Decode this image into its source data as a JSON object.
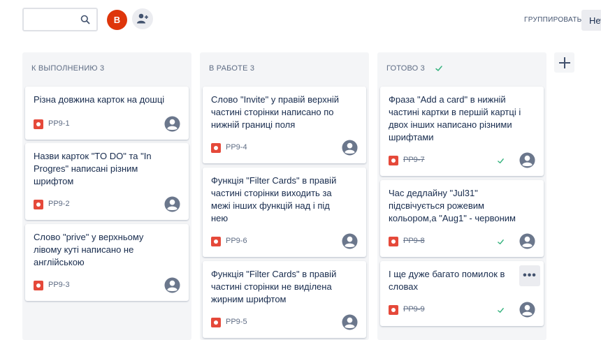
{
  "toolbar": {
    "search_placeholder": "",
    "user_avatar_initial": "B",
    "group_by_label": "ГРУППИРОВАТЬ:",
    "group_by_value": "Нет"
  },
  "columns": [
    {
      "title": "К ВЫПОЛНЕНИЮ 3",
      "cards": [
        {
          "title": "Різна довжина карток на дошці",
          "key": "PP9-1"
        },
        {
          "title": "Назви карток \"TO DO\" та \"In Progres\" написані різним шрифтом",
          "key": "PP9-2"
        },
        {
          "title": "Слово \"prive\" у верхньому лівому куті написано не англійською",
          "key": "PP9-3"
        }
      ]
    },
    {
      "title": "В РАБОТЕ 3",
      "cards": [
        {
          "title": "Слово \"Invite\" у правій верхній частині сторінки написано по нижній границі поля",
          "key": "PP9-4"
        },
        {
          "title": "Функція \"Filter Cards\" в правій частині сторінки виходить за межі інших функцій над і під нею",
          "key": "PP9-6"
        },
        {
          "title": "Функція \"Filter Cards\" в правій частині сторінки не виділена жирним шрифтом",
          "key": "PP9-5"
        }
      ]
    },
    {
      "title": "ГОТОВО 3",
      "cards": [
        {
          "title": "Фраза \"Add a card\" в нижній частині картки в першій картці і двох інших написано різними шрифтами",
          "key": "PP9-7"
        },
        {
          "title": "Час дедлайну \"Jul31\" підсвічується рожевим кольором,а \"Aug1\" - червоним",
          "key": "PP9-8"
        },
        {
          "title": "І ще дуже багато помилок в словах",
          "key": "PP9-9"
        }
      ]
    }
  ],
  "icons": {
    "search": "search-icon",
    "add_person": "add-person-icon",
    "issue_type": "bug-icon",
    "assignee": "user-avatar-icon",
    "done": "check-icon",
    "more": "more-icon",
    "add_column": "plus-icon"
  },
  "colors": {
    "column_bg": "#f4f5f7",
    "bug": "#e5493a",
    "avatar_b": "#de350b",
    "done_check": "#36b37e"
  },
  "more_glyph": "•••"
}
